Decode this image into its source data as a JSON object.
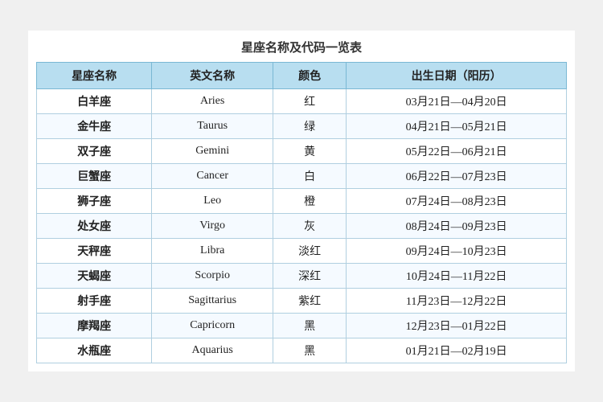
{
  "title": "星座名称及代码一览表",
  "headers": [
    "星座名称",
    "英文名称",
    "颜色",
    "出生日期（阳历）"
  ],
  "rows": [
    {
      "chinese": "白羊座",
      "english": "Aries",
      "color": "红",
      "date": "03月21日—04月20日"
    },
    {
      "chinese": "金牛座",
      "english": "Taurus",
      "color": "绿",
      "date": "04月21日—05月21日"
    },
    {
      "chinese": "双子座",
      "english": "Gemini",
      "color": "黄",
      "date": "05月22日—06月21日"
    },
    {
      "chinese": "巨蟹座",
      "english": "Cancer",
      "color": "白",
      "date": "06月22日—07月23日"
    },
    {
      "chinese": "狮子座",
      "english": "Leo",
      "color": "橙",
      "date": "07月24日—08月23日"
    },
    {
      "chinese": "处女座",
      "english": "Virgo",
      "color": "灰",
      "date": "08月24日—09月23日"
    },
    {
      "chinese": "天秤座",
      "english": "Libra",
      "color": "淡红",
      "date": "09月24日—10月23日"
    },
    {
      "chinese": "天蝎座",
      "english": "Scorpio",
      "color": "深红",
      "date": "10月24日—11月22日"
    },
    {
      "chinese": "射手座",
      "english": "Sagittarius",
      "color": "紫红",
      "date": "11月23日—12月22日"
    },
    {
      "chinese": "摩羯座",
      "english": "Capricorn",
      "color": "黑",
      "date": "12月23日—01月22日"
    },
    {
      "chinese": "水瓶座",
      "english": "Aquarius",
      "color": "黑",
      "date": "01月21日—02月19日"
    }
  ]
}
